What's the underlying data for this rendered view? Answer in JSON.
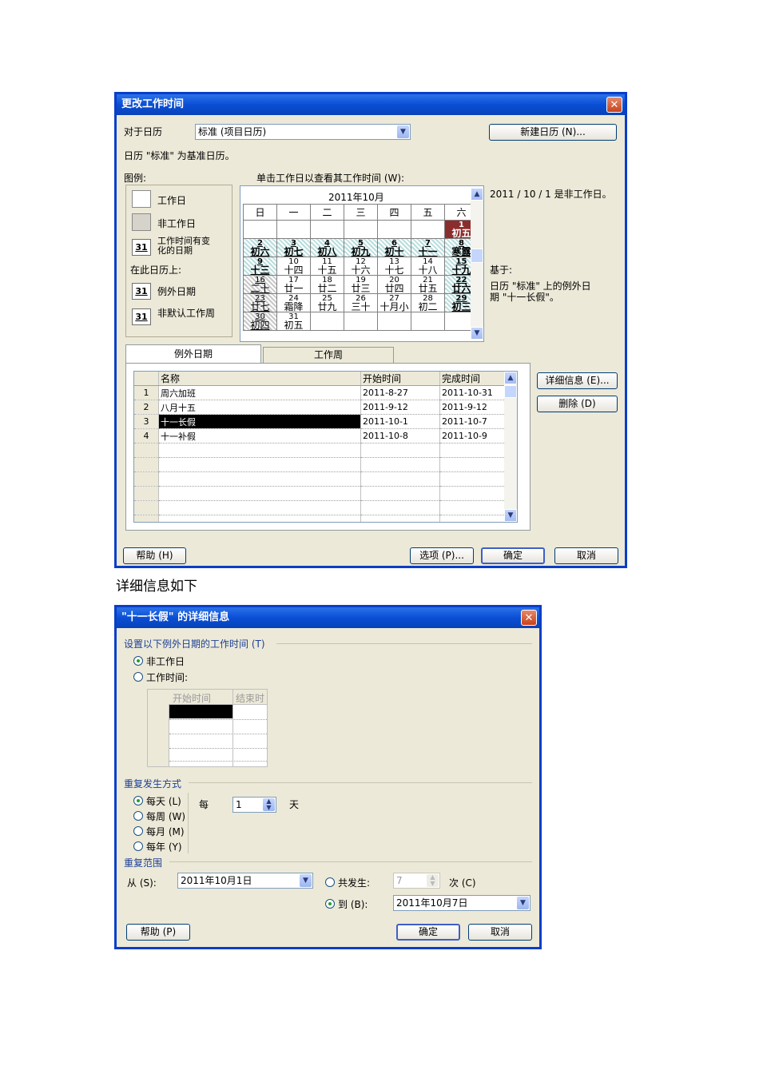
{
  "dialog1": {
    "title": "更改工作时间",
    "for_calendar_label": "对于日历",
    "calendar_value": "标准 (项目日历)",
    "new_calendar_btn": "新建日历 (N)...",
    "base_calendar_note": "日历 \"标准\" 为基准日历。",
    "legend_title": "图例:",
    "legend": {
      "work": "工作日",
      "nonwork": "非工作日",
      "edited_line1": "工作时间有变",
      "edited_line2": "化的日期",
      "on_this_calendar": "在此日历上:",
      "exception_day": "例外日期",
      "nondefault_week": "非默认工作周",
      "icon31": "31"
    },
    "click_hint": "单击工作日以查看其工作时间 (W):",
    "month_title": "2011年10月",
    "weekdays": [
      "日",
      "一",
      "二",
      "三",
      "四",
      "五",
      "六"
    ],
    "cal_rows": [
      [
        [
          "",
          ""
        ],
        [
          "",
          ""
        ],
        [
          "",
          ""
        ],
        [
          "",
          ""
        ],
        [
          "",
          ""
        ],
        [
          "",
          ""
        ],
        [
          "1",
          "初五"
        ]
      ],
      [
        [
          "2",
          "初六"
        ],
        [
          "3",
          "初七"
        ],
        [
          "4",
          "初八"
        ],
        [
          "5",
          "初九"
        ],
        [
          "6",
          "初十"
        ],
        [
          "7",
          "十一"
        ],
        [
          "8",
          "寒露"
        ]
      ],
      [
        [
          "9",
          "十三"
        ],
        [
          "10",
          "十四"
        ],
        [
          "11",
          "十五"
        ],
        [
          "12",
          "十六"
        ],
        [
          "13",
          "十七"
        ],
        [
          "14",
          "十八"
        ],
        [
          "15",
          "十九"
        ]
      ],
      [
        [
          "16",
          "二十"
        ],
        [
          "17",
          "廿一"
        ],
        [
          "18",
          "廿二"
        ],
        [
          "19",
          "廿三"
        ],
        [
          "20",
          "廿四"
        ],
        [
          "21",
          "廿五"
        ],
        [
          "22",
          "廿六"
        ]
      ],
      [
        [
          "23",
          "廿七"
        ],
        [
          "24",
          "霜降"
        ],
        [
          "25",
          "廿九"
        ],
        [
          "26",
          "三十"
        ],
        [
          "27",
          "十月小"
        ],
        [
          "28",
          "初二"
        ],
        [
          "29",
          "初三"
        ]
      ],
      [
        [
          "30",
          "初四"
        ],
        [
          "31",
          "初五"
        ],
        [
          "",
          ""
        ],
        [
          "",
          ""
        ],
        [
          "",
          ""
        ],
        [
          "",
          ""
        ],
        [
          "",
          ""
        ]
      ]
    ],
    "status_line": "2011 / 10 / 1 是非工作日。",
    "based_on_label": "基于:",
    "based_on_text_line1": "日历 \"标准\" 上的例外日",
    "based_on_text_line2": "期 \"十一长假\"。",
    "tabs": [
      "例外日期",
      "工作周"
    ],
    "table_headers": [
      "名称",
      "开始时间",
      "完成时间"
    ],
    "table_rows": [
      {
        "num": "1",
        "name": "周六加班",
        "start": "2011-8-27",
        "end": "2011-10-31"
      },
      {
        "num": "2",
        "name": "八月十五",
        "start": "2011-9-12",
        "end": "2011-9-12"
      },
      {
        "num": "3",
        "name": "十一长假",
        "start": "2011-10-1",
        "end": "2011-10-7"
      },
      {
        "num": "4",
        "name": "十一补假",
        "start": "2011-10-8",
        "end": "2011-10-9"
      }
    ],
    "details_btn": "详细信息 (E)...",
    "delete_btn": "删除 (D)",
    "help_btn": "帮助 (H)",
    "options_btn": "选项 (P)...",
    "ok_btn": "确定",
    "cancel_btn": "取消"
  },
  "caption": "详细信息如下",
  "dialog2": {
    "title": "\"十一长假\" 的详细信息",
    "set_worktime_label": "设置以下例外日期的工作时间 (T)",
    "nonwork_radio": "非工作日",
    "worktime_radio": "工作时间:",
    "time_headers": [
      "开始时间",
      "结束时"
    ],
    "recurrence_label": "重复发生方式",
    "daily": "每天 (L)",
    "weekly": "每周 (W)",
    "monthly": "每月 (M)",
    "yearly": "每年 (Y)",
    "every_label": "每",
    "every_value": "1",
    "day_unit": "天",
    "range_label": "重复范围",
    "from_label": "从 (S):",
    "from_value": "2011年10月1日",
    "occur_label": "共发生:",
    "occur_value": "7",
    "times_label": "次 (C)",
    "to_label": "到 (B):",
    "to_value": "2011年10月7日",
    "help_btn": "帮助 (P)",
    "ok_btn": "确定",
    "cancel_btn": "取消"
  }
}
